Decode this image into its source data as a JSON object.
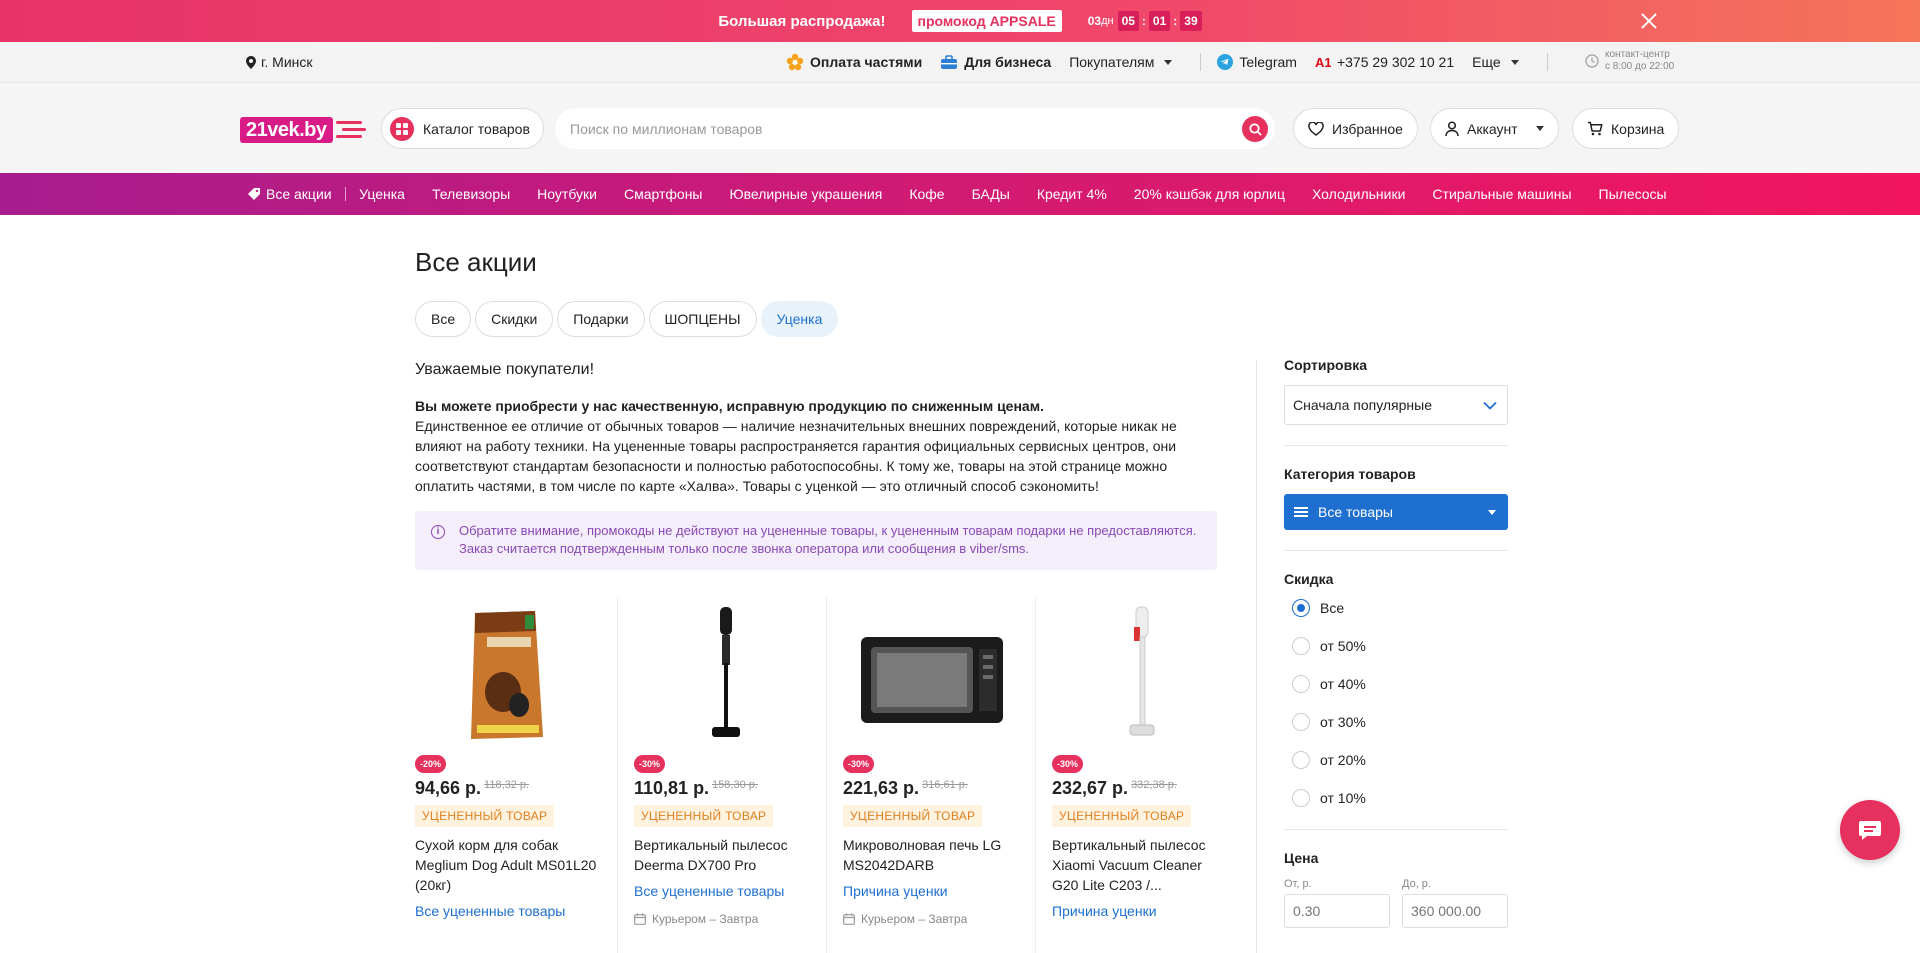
{
  "promo": {
    "title": "Большая распродажа!",
    "code": "промокод APPSALE",
    "days": "03",
    "days_unit": "дн",
    "hours": "05",
    "minutes": "01",
    "seconds": "39",
    "timer_sep": ":"
  },
  "topbar": {
    "city": "г. Минск",
    "installments": "Оплата частями",
    "business": "Для бизнеса",
    "buyers": "Покупателям",
    "telegram": "Telegram",
    "phone": "+375 29 302 10 21",
    "more": "Еще",
    "contact_line1": "контакт-центр",
    "contact_line2": "с 8:00 до 22:00"
  },
  "header": {
    "logo": "21vek.by",
    "catalog": "Каталог товаров",
    "search_placeholder": "Поиск по миллионам товаров",
    "favorites": "Избранное",
    "account": "Аккаунт",
    "cart": "Корзина"
  },
  "catnav": {
    "items": [
      "Все акции",
      "Уценка",
      "Телевизоры",
      "Ноутбуки",
      "Смартфоны",
      "Ювелирные украшения",
      "Кофе",
      "БАДы",
      "Кредит 4%",
      "20% кэшбэк для юрлиц",
      "Холодильники",
      "Стиральные машины",
      "Пылесосы"
    ]
  },
  "main": {
    "title": "Все акции",
    "tabs": [
      "Все",
      "Скидки",
      "Подарки",
      "ШОПЦЕНЫ",
      "Уценка"
    ],
    "active_tab": "Уценка",
    "greeting": "Уважаемые покупатели!",
    "lead": "Вы можете приобрести у нас качественную, исправную продукцию по сниженным ценам.",
    "body": "Единственное ее отличие от обычных товаров — наличие незначительных внешних повреждений, которые никак не влияют на работу техники. На уцененные товары распространяется гарантия официальных сервисных центров, они соответствуют стандартам безопасности и полностью работоспособны. К тому же, товары на этой странице можно оплатить частями, в том числе по карте «Халва». Товары с уценкой — это отличный способ сэкономить!",
    "notice": "Обратите внимание, промокоды не действуют на уцененные товары, к уцененным товарам подарки не предоставляются. Заказ считается подтвержденным только после звонка оператора или сообщения в viber/sms."
  },
  "products": [
    {
      "discount": "-20%",
      "price": "94,66 р.",
      "old_price": "118,32 р.",
      "tag": "УЦЕНЕННЫЙ ТОВАР",
      "name": "Сухой корм для собак Meglium Dog Adult MS01L20 (20кг)",
      "link": "Все уцененные товары",
      "delivery": ""
    },
    {
      "discount": "-30%",
      "price": "110,81 р.",
      "old_price": "158,30 р.",
      "tag": "УЦЕНЕННЫЙ ТОВАР",
      "name": "Вертикальный пылесос Deerma DX700 Pro",
      "link": "Все уцененные товары",
      "delivery": "Курьером – Завтра"
    },
    {
      "discount": "-30%",
      "price": "221,63 р.",
      "old_price": "316,61 р.",
      "tag": "УЦЕНЕННЫЙ ТОВАР",
      "name": "Микроволновая печь LG MS2042DARB",
      "link": "Причина уценки",
      "delivery": "Курьером – Завтра"
    },
    {
      "discount": "-30%",
      "price": "232,67 р.",
      "old_price": "332,38 р.",
      "tag": "УЦЕНЕННЫЙ ТОВАР",
      "name": "Вертикальный пылесос Xiaomi Vacuum Cleaner G20 Lite C203 /...",
      "link": "Причина уценки",
      "delivery": ""
    }
  ],
  "sidebar": {
    "sort_title": "Сортировка",
    "sort_value": "Сначала популярные",
    "category_title": "Категория товаров",
    "category_value": "Все товары",
    "discount_title": "Скидка",
    "discount_options": [
      "Все",
      "от 50%",
      "от 40%",
      "от 30%",
      "от 20%",
      "от 10%"
    ],
    "discount_selected": "Все",
    "price_title": "Цена",
    "price_from_label": "От, р.",
    "price_to_label": "До, р.",
    "price_from_placeholder": "0.30",
    "price_to_placeholder": "360 000.00"
  },
  "colors": {
    "brand": "#e6305e",
    "accent_blue": "#1f6fd1",
    "tag_orange": "#e2801f",
    "notice_purple": "#8a49b5"
  }
}
